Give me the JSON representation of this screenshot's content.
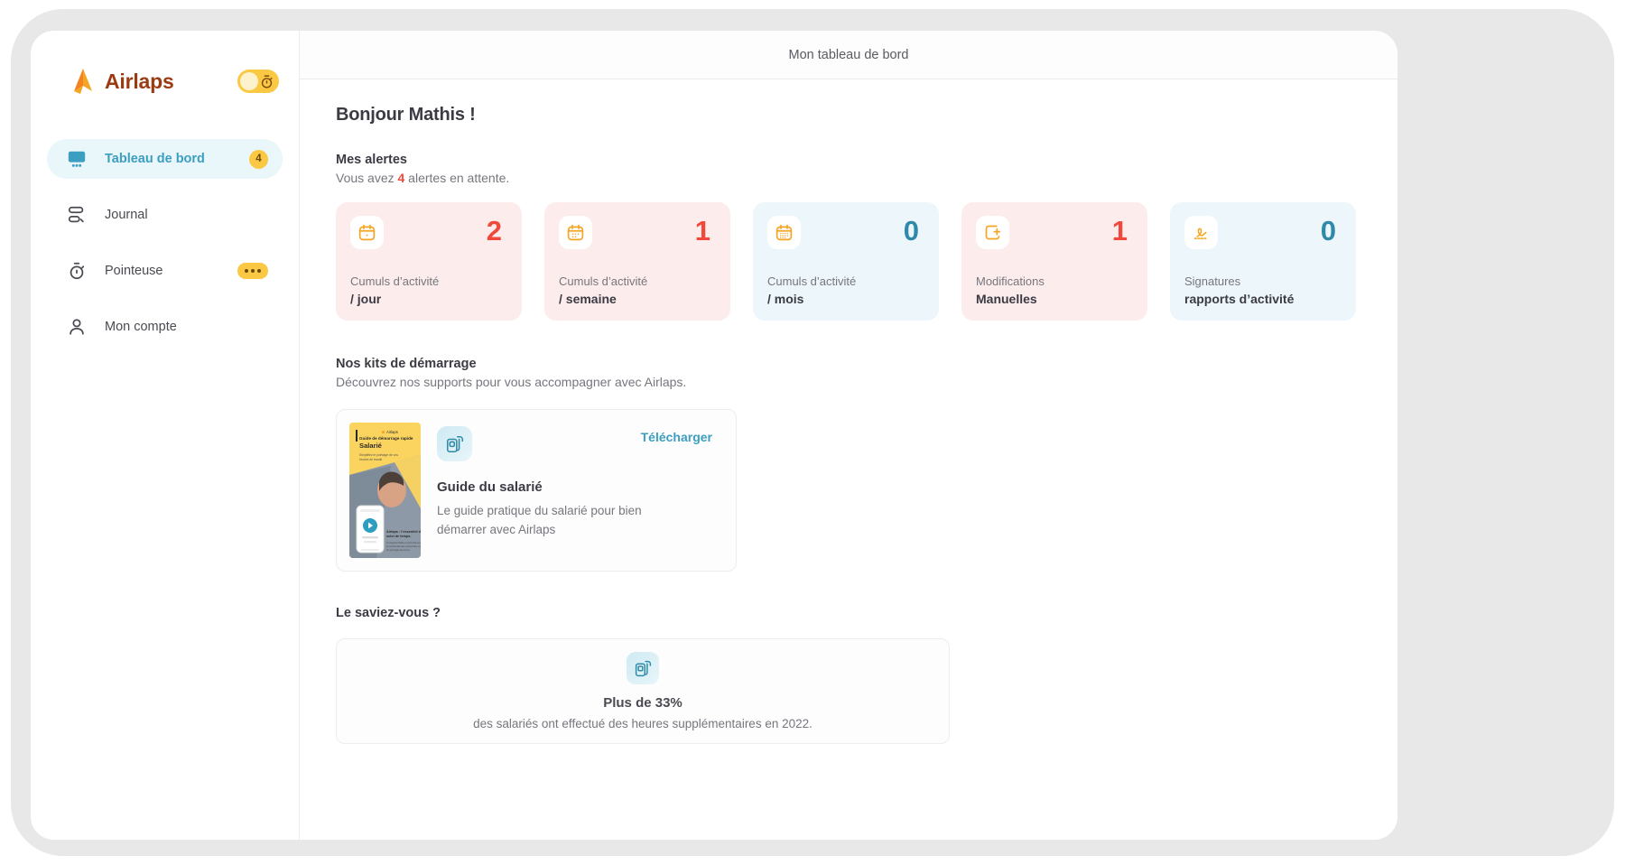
{
  "brand": {
    "name": "Airlaps",
    "logo_icon": "airlaps-arrow-logo",
    "toggle_icon": "stopwatch-icon",
    "toggle_state": "on"
  },
  "sidebar": {
    "items": [
      {
        "label": "Tableau de bord",
        "icon": "monitor-icon",
        "active": true,
        "badge": "4",
        "badge_type": "count"
      },
      {
        "label": "Journal",
        "icon": "journal-layout-icon",
        "active": false,
        "badge": "",
        "badge_type": "none"
      },
      {
        "label": "Pointeuse",
        "icon": "stopwatch-icon",
        "active": false,
        "badge": "...",
        "badge_type": "dots"
      },
      {
        "label": "Mon compte",
        "icon": "user-icon",
        "active": false,
        "badge": "",
        "badge_type": "none"
      }
    ]
  },
  "topbar": {
    "title": "Mon tableau de bord"
  },
  "main": {
    "greeting": "Bonjour Mathis !",
    "alerts_section": {
      "title": "Mes alertes",
      "sub_prefix": "Vous avez ",
      "sub_count": "4",
      "sub_suffix": " alertes en attente.",
      "cards": [
        {
          "icon": "calendar-day-icon",
          "value": "2",
          "line1": "Cumuls d’activité",
          "line2": "/ jour",
          "tone": "red"
        },
        {
          "icon": "calendar-week-icon",
          "value": "1",
          "line1": "Cumuls d’activité",
          "line2": "/ semaine",
          "tone": "red"
        },
        {
          "icon": "calendar-month-icon",
          "value": "0",
          "line1": "Cumuls d’activité",
          "line2": "/ mois",
          "tone": "blue"
        },
        {
          "icon": "add-square-icon",
          "value": "1",
          "line1": "Modifications",
          "line2": "Manuelles",
          "tone": "red"
        },
        {
          "icon": "signature-icon",
          "value": "0",
          "line1": "Signatures",
          "line2": "rapports d’activité",
          "tone": "blue"
        }
      ]
    },
    "kits_section": {
      "title": "Nos kits de démarrage",
      "subtitle": "Découvrez nos supports pour vous accompagner avec Airlaps.",
      "card": {
        "icon": "documents-copy-icon",
        "download_label": "Télécharger",
        "title": "Guide du salarié",
        "description": "Le guide pratique du salarié pour bien démarrer avec Airlaps",
        "thumbnail": {
          "brand": "Airlaps",
          "eyebrow": "Guide de démarrage rapide",
          "heading": "Salarié",
          "sub": "Simplifiez le pointage de vos heures de travail.",
          "footer_title": "Airlaps : l’essentiel du suivi de temps.",
          "footer_text": "Un logiciel fiable et sécurisé pour assurer la conformité des entreprises en matière de pointage de temps."
        }
      }
    },
    "dyk_section": {
      "title": "Le saviez-vous ?",
      "icon": "documents-copy-icon",
      "stat": "Plus de 33%",
      "text": "des salariés ont effectué des heures supplémentaires en 2022."
    }
  },
  "colors": {
    "brand_orange": "#f5a524",
    "brand_name": "#9a3b12",
    "accent_blue": "#3c9ec0",
    "alert_red": "#f1483c",
    "alert_blue": "#2e8aa8",
    "badge_yellow": "#fbc843",
    "card_red_bg": "#fcecec",
    "card_blue_bg": "#edf6fa"
  }
}
